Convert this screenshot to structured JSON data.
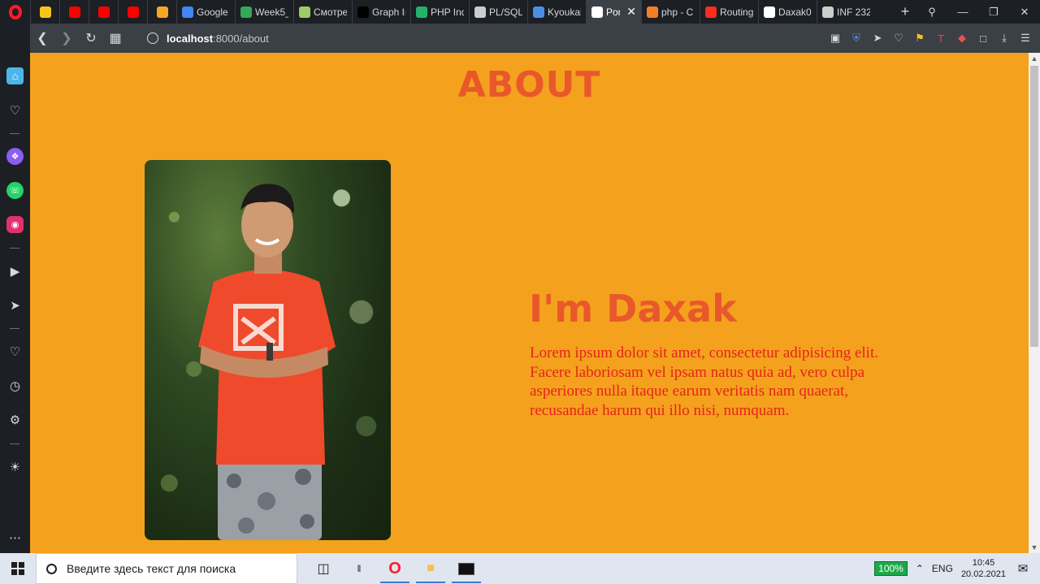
{
  "browser": {
    "tabs": [
      {
        "label": "",
        "favicon_color": "#f5c518",
        "pinned": true
      },
      {
        "label": "",
        "favicon_color": "#ff0000",
        "pinned": true
      },
      {
        "label": "",
        "favicon_color": "#ff0000",
        "pinned": true
      },
      {
        "label": "",
        "favicon_color": "#ff0000",
        "pinned": true
      },
      {
        "label": "",
        "favicon_color": "#f5a623",
        "pinned": true
      },
      {
        "label": "Google",
        "favicon_color": "#4285f4"
      },
      {
        "label": "Week5_",
        "favicon_color": "#34a853"
      },
      {
        "label": "Смотре",
        "favicon_color": "#9ccc65"
      },
      {
        "label": "Graph Ir",
        "favicon_color": "#000000"
      },
      {
        "label": "PHP Ind",
        "favicon_color": "#21b36b"
      },
      {
        "label": "PL/SQL",
        "favicon_color": "#cccccc"
      },
      {
        "label": "Kyoukai",
        "favicon_color": "#4a90e2"
      },
      {
        "label": "Port",
        "favicon_color": "#ffffff",
        "active": true
      },
      {
        "label": "php - C",
        "favicon_color": "#f48024"
      },
      {
        "label": "Routing",
        "favicon_color": "#ff2d20"
      },
      {
        "label": "Daxak0",
        "favicon_color": "#ffffff"
      },
      {
        "label": "INF 232",
        "favicon_color": "#cccccc"
      }
    ],
    "new_tab_label": "+",
    "url_host": "localhost",
    "url_path": ":8000/about"
  },
  "page": {
    "title": "ABOUT",
    "heading": "I'm Daxak",
    "bio": "Lorem ipsum dolor sit amet, consectetur adipisicing elit. Facere laboriosam vel ipsam natus quia ad, vero culpa asperiores nulla itaque earum veritatis nam quaerat, recusandae harum qui illo nisi, numquam.",
    "accent_color": "#e8582b",
    "background_color": "#f4a11d",
    "bio_color": "#e5241b"
  },
  "taskbar": {
    "search_placeholder": "Введите здесь текст для поиска",
    "battery": "100%",
    "language": "ENG",
    "time": "10:45",
    "date": "20.02.2021"
  }
}
